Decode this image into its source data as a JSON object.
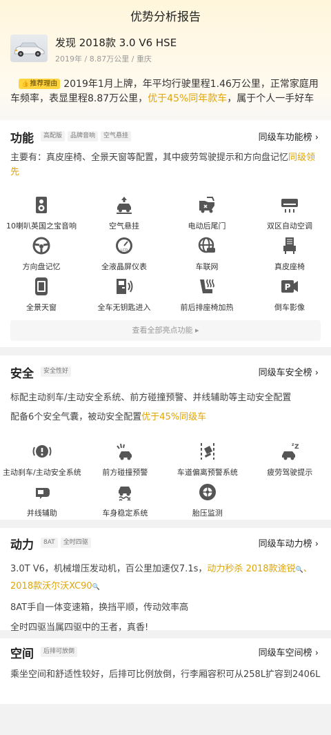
{
  "page": {
    "title": "优势分析报告"
  },
  "car": {
    "name": "发现 2018款 3.0 V6 HSE",
    "year": "2019年",
    "mileage": "8.87万公里",
    "city": "重庆",
    "sep": "/"
  },
  "reason": {
    "tag": "推荐理由",
    "text_a": "2019年1月上牌，年平均行驶里程1.46万公里，正常家庭用车频率，表显里程8.87万公里，",
    "highlight": "优于45%同年款车",
    "text_b": "，属于个人一手好车"
  },
  "function_section": {
    "title": "功能",
    "tags": [
      "高配版",
      "品牌音响",
      "空气悬挂"
    ],
    "rank_link": "同级车功能榜 ›",
    "desc_a": "主要有：真皮座椅、全景天窗等配置，其中疲劳驾驶提示和方向盘记忆",
    "desc_hl": "同级领先",
    "features": [
      {
        "label": "10喇叭英国之宝音响",
        "icon": "speaker-icon"
      },
      {
        "label": "空气悬挂",
        "icon": "air-suspension-icon"
      },
      {
        "label": "电动后尾门",
        "icon": "power-tailgate-icon"
      },
      {
        "label": "双区自动空调",
        "icon": "dual-zone-ac-icon"
      },
      {
        "label": "方向盘记忆",
        "icon": "steering-memory-icon"
      },
      {
        "label": "全液晶屏仪表",
        "icon": "lcd-gauge-icon"
      },
      {
        "label": "车联网",
        "icon": "connected-car-icon"
      },
      {
        "label": "真皮座椅",
        "icon": "leather-seat-icon"
      },
      {
        "label": "全景天窗",
        "icon": "panoramic-sunroof-icon"
      },
      {
        "label": "全车无钥匙进入",
        "icon": "keyless-entry-icon"
      },
      {
        "label": "前后排座椅加热",
        "icon": "seat-heating-icon"
      },
      {
        "label": "倒车影像",
        "icon": "reverse-camera-icon"
      }
    ],
    "more_label": "查看全部亮点功能 ▸"
  },
  "safety_section": {
    "title": "安全",
    "tags": [
      "安全性好"
    ],
    "rank_link": "同级车安全榜 ›",
    "line1": "标配主动刹车/主动安全系统、前方碰撞预警、并线辅助等主动安全配置",
    "line2_a": "配备6个安全气囊，被动安全配置",
    "line2_hl": "优于45%同级车",
    "features": [
      {
        "label": "主动刹车/主动安全系统",
        "icon": "active-brake-icon"
      },
      {
        "label": "前方碰撞预警",
        "icon": "collision-warning-icon"
      },
      {
        "label": "车道偏离预警系统",
        "icon": "lane-departure-icon"
      },
      {
        "label": "疲劳驾驶提示",
        "icon": "fatigue-alert-icon"
      },
      {
        "label": "并线辅助",
        "icon": "blind-spot-icon"
      },
      {
        "label": "车身稳定系统",
        "icon": "stability-control-icon"
      },
      {
        "label": "胎压监测",
        "icon": "tire-pressure-icon"
      }
    ]
  },
  "power_section": {
    "title": "动力",
    "tags": [
      "8AT",
      "全时四驱"
    ],
    "rank_link": "同级车动力榜 ›",
    "line1_a": "3.0T V6，机械增压发动机，百公里加速仅7.1s，",
    "line1_hl": "动力秒杀 2018款途锐",
    "sep": "、",
    "line1_hl2": "2018款沃尔沃XC90",
    "line2": "8AT手自一体变速箱，换挡平顺，传动效率高",
    "line3": "全时四驱当属四驱中的王者，真香!"
  },
  "space_section": {
    "title": "空间",
    "tags": [
      "后排可放倒"
    ],
    "rank_link": "同级车空间榜 ›",
    "desc": "乘坐空间和舒适性较好，后排可比例放倒，行李厢容积可从258L扩容到2406L"
  },
  "colors": {
    "accent": "#e0a500",
    "tag_yellow": "#ffd43d",
    "icon": "#555555"
  }
}
